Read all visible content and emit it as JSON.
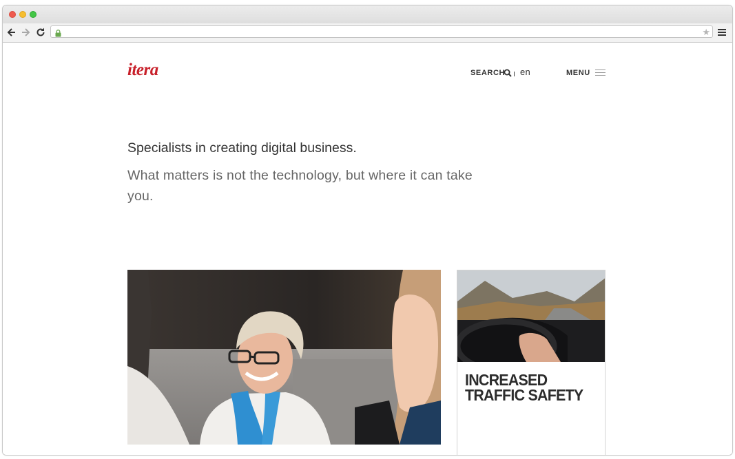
{
  "browser": {
    "address": "",
    "colors": {
      "close": "#ef5a4e",
      "minimize": "#f6be2f",
      "maximize": "#43c646"
    }
  },
  "header": {
    "logo_text": "itera",
    "search_label": "SEARCH",
    "language": "en",
    "menu_label": "MENU"
  },
  "hero": {
    "headline": "Specialists in creating digital business.",
    "subline": "What matters is not the technology, but where it can take you."
  },
  "cards": {
    "feature_title": "INCREASED TRAFFIC SAFETY"
  },
  "colors": {
    "brand": "#c8202a",
    "text": "#333333",
    "subtext": "#666666"
  }
}
